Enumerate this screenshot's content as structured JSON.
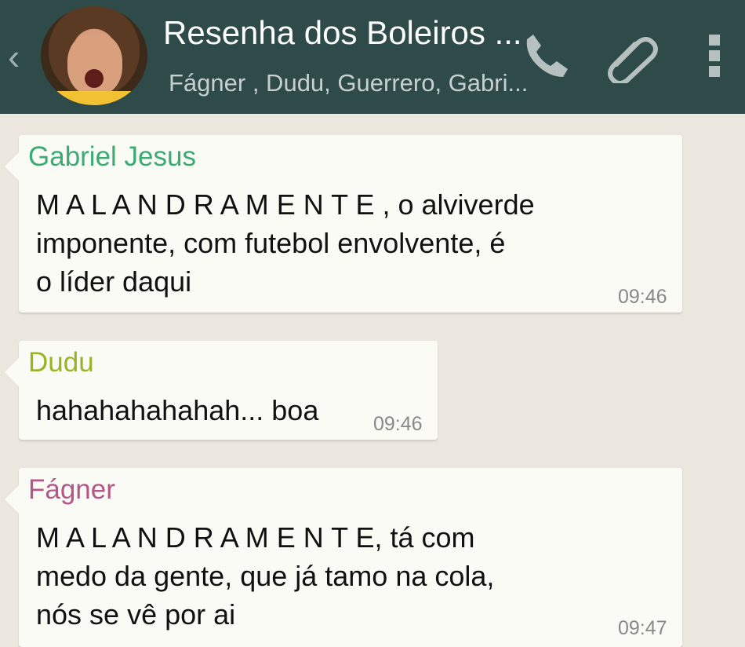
{
  "header": {
    "title": "Resenha dos Boleiros ...",
    "subtitle": "Fágner , Dudu, Guerrero, Gabri...",
    "back_icon": "chevron-left-icon",
    "avatar_icon": "group-avatar",
    "actions": [
      "phone-icon",
      "paperclip-icon",
      "overflow-menu-icon"
    ]
  },
  "messages": [
    {
      "sender": "Gabriel Jesus",
      "sender_color": "#3cab73",
      "lines": [
        "M A L A N D R A M E N T E , o alviverde",
        "imponente, com futebol envolvente, é",
        "o líder daqui"
      ],
      "time": "09:46"
    },
    {
      "sender": "Dudu",
      "sender_color": "#98b324",
      "lines": [
        "hahahahahahah... boa"
      ],
      "time": "09:46"
    },
    {
      "sender": "Fágner",
      "sender_color": "#b25787",
      "lines": [
        "M A L A N D R A M E N T E, tá com",
        "medo da gente, que já tamo na cola,",
        "nós se vê por ai"
      ],
      "time": "09:47"
    }
  ]
}
